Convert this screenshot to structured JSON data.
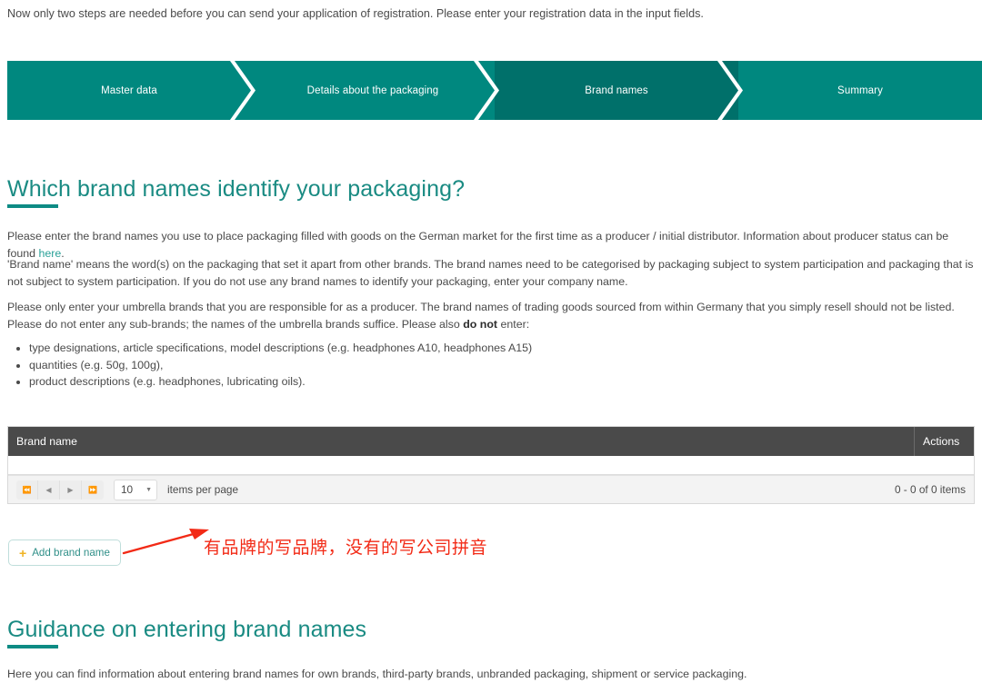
{
  "intro": {
    "text": "Now only two steps are needed before you can send your application of registration. Please enter your registration data in the input fields."
  },
  "stepper": {
    "steps": [
      {
        "label": "Master data",
        "active": false
      },
      {
        "label": "Details about the packaging",
        "active": false
      },
      {
        "label": "Brand names",
        "active": true
      },
      {
        "label": "Summary",
        "active": false
      }
    ],
    "colors": {
      "inactive": "#00887f",
      "active": "#00706a",
      "label": "#ffffff"
    }
  },
  "brand_section": {
    "heading": "Which brand names identify your packaging?",
    "paragraph_1_before_link": "Please enter the brand names you use to place packaging filled with goods on the German market for the first time as a producer / initial distributor. Information about producer status can be found ",
    "paragraph_1_link": "here",
    "paragraph_1_after_link": ".",
    "paragraph_2": "'Brand name' means the word(s) on the packaging that set it apart from other brands. The brand names need to be categorised by packaging subject to system participation and packaging that is not subject to system participation. If you do not use any brand names to identify your packaging, enter your company name.",
    "paragraph_3_part_1": "Please only enter your umbrella brands that you are responsible for as a producer. The brand names of trading goods sourced from within Germany that you simply resell should not be listed. Please do not enter any sub-brands; the names of the umbrella brands suffice. Please also ",
    "paragraph_3_strong": "do not",
    "paragraph_3_part_2": " enter:",
    "bullets": [
      "type designations, article specifications, model descriptions (e.g. headphones A10, headphones A15)",
      "quantities (e.g. 50g, 100g),",
      "product descriptions (e.g. headphones, lubricating oils)."
    ]
  },
  "grid": {
    "columns": {
      "brand_name": "Brand name",
      "actions": "Actions"
    },
    "rows": [],
    "pager": {
      "first_icon": "first-page-icon",
      "prev_icon": "previous-page-icon",
      "next_icon": "next-page-icon",
      "last_icon": "last-page-icon",
      "page_size": "10",
      "page_size_label": "items per page",
      "count_text": "0 - 0 of 0 items"
    }
  },
  "add_button": {
    "icon": "plus-icon",
    "label": "Add brand name"
  },
  "annotation": {
    "text": "有品牌的写品牌，没有的写公司拼音",
    "color": "#f22a16",
    "arrow": "arrow-pointing-to-add-brand-name-button"
  },
  "guidance_section": {
    "heading": "Guidance on entering brand names",
    "paragraph": "Here you can find information about entering brand names for own brands, third-party brands, unbranded packaging, shipment or service packaging."
  },
  "theme": {
    "teal_heading": "#1a8b83",
    "teal_rule": "#0d8b84",
    "link": "#2aa198",
    "grid_header_bg": "#4a4a4a",
    "plus_amber": "#f0b323"
  }
}
